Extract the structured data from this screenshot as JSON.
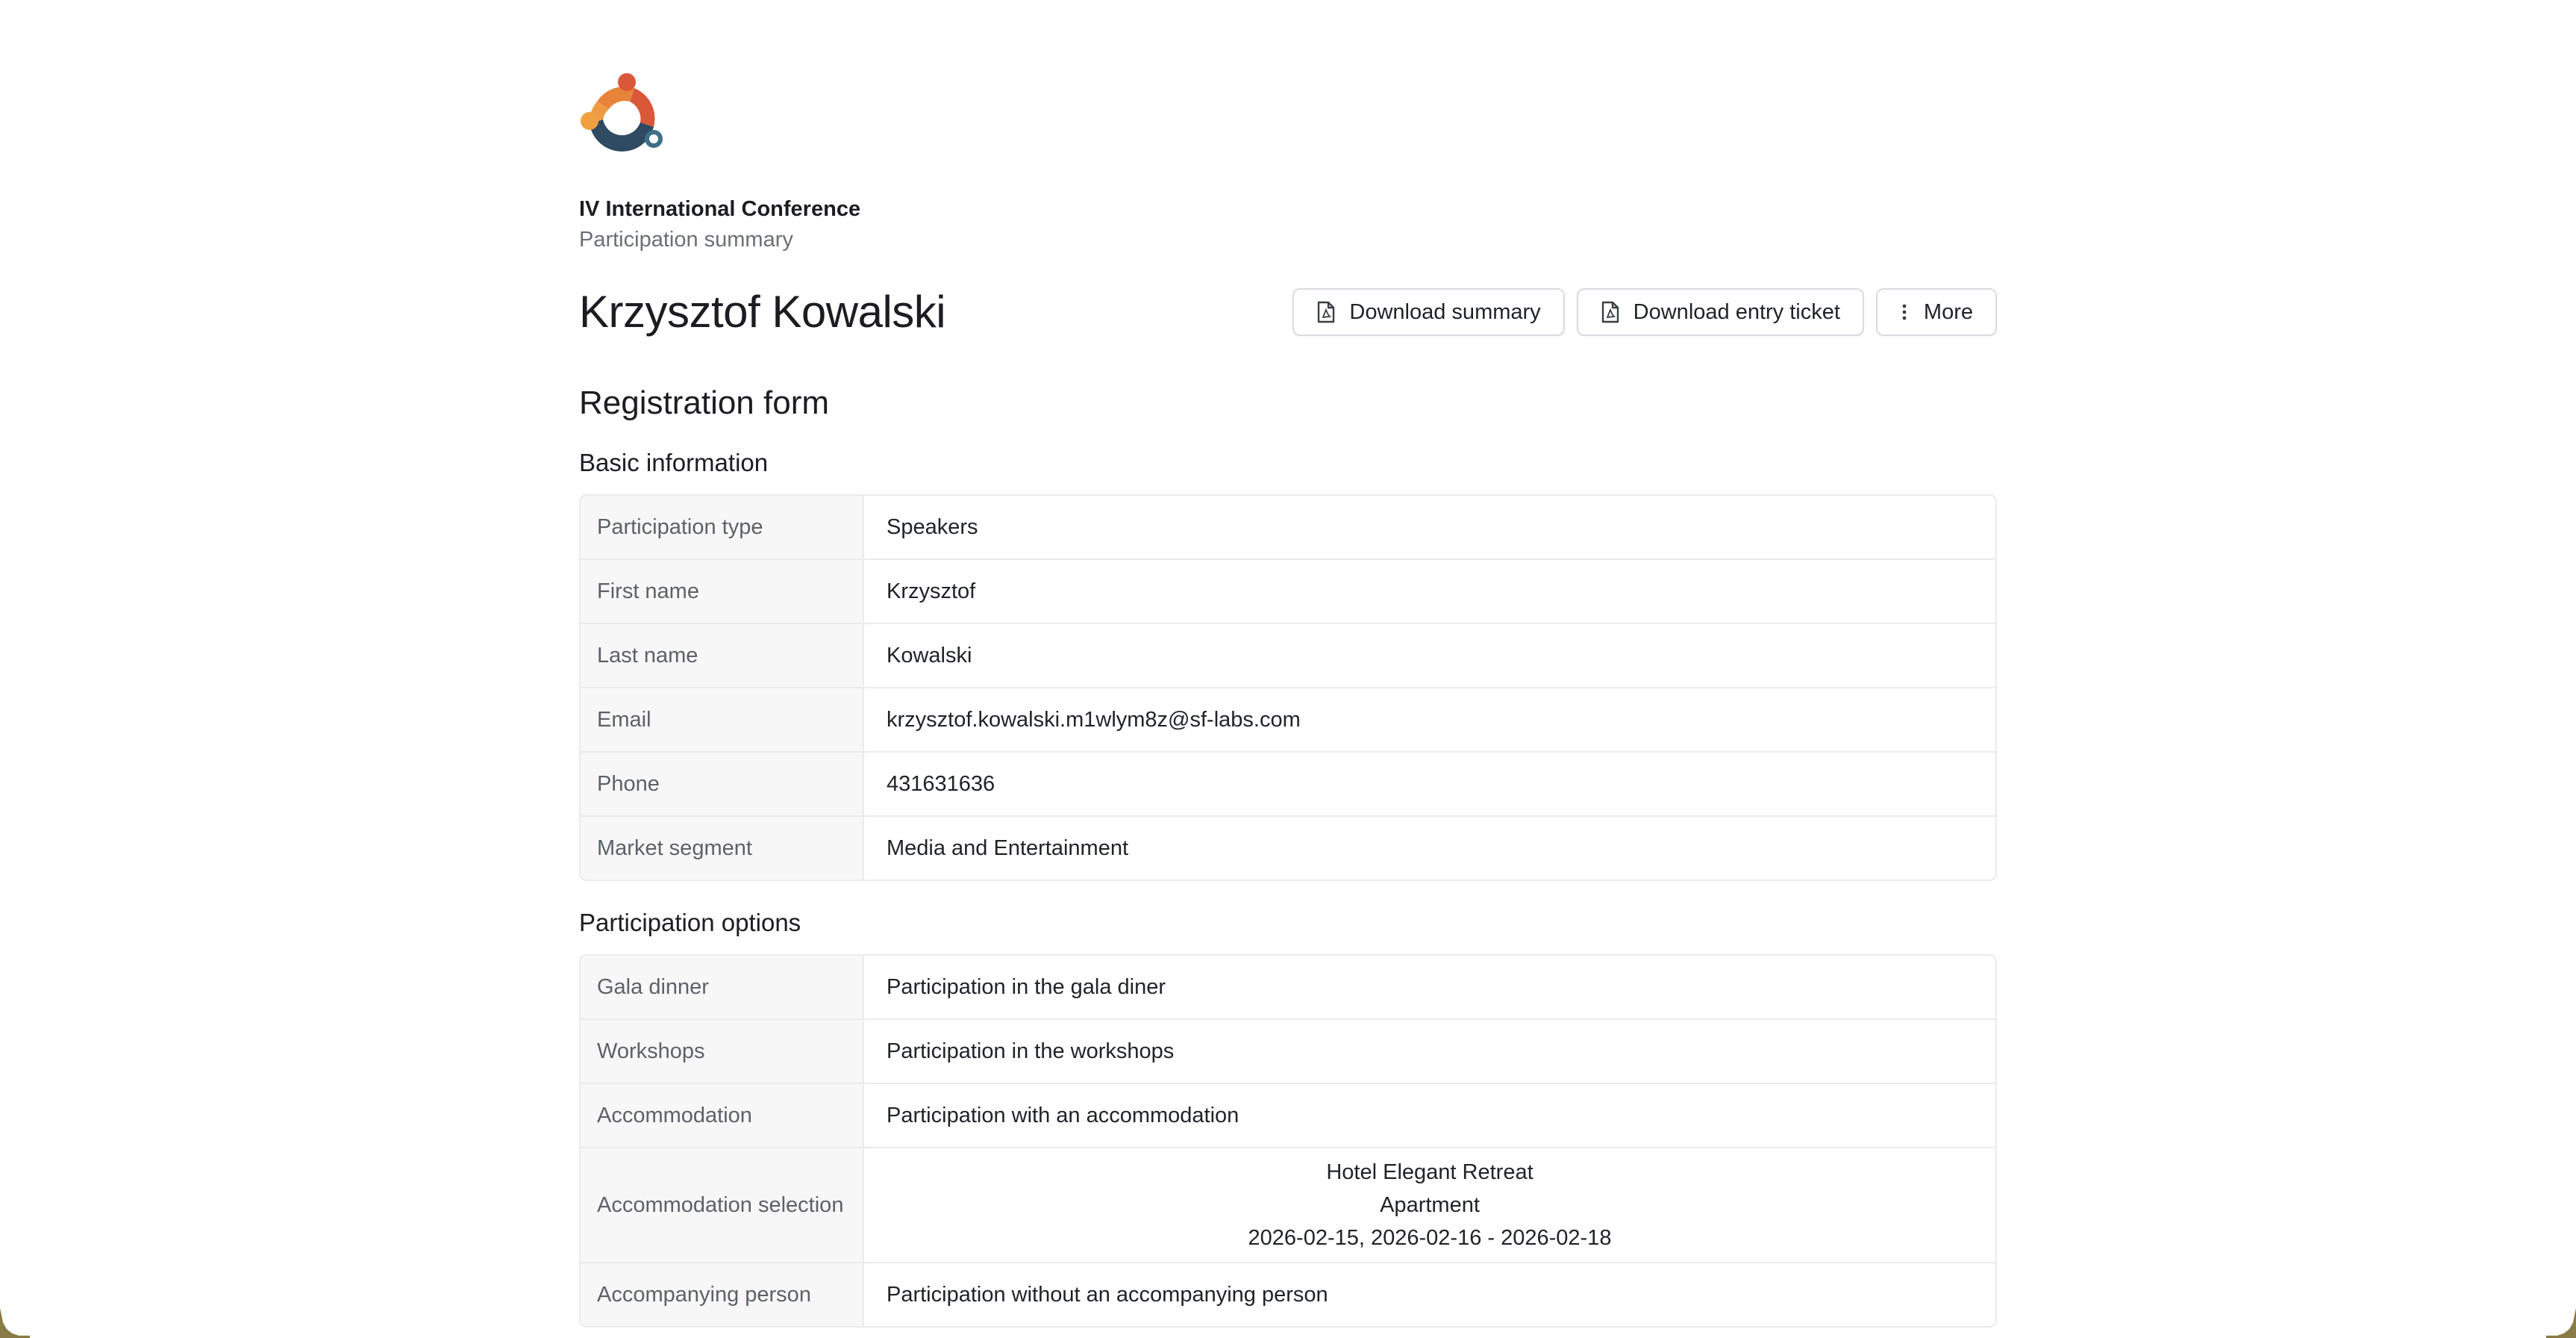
{
  "header": {
    "conference_title": "IV International Conference",
    "page_subtitle": "Participation summary",
    "person_name": "Krzysztof Kowalski"
  },
  "actions": {
    "download_summary": "Download summary",
    "download_ticket": "Download entry ticket",
    "more": "More"
  },
  "form": {
    "title": "Registration form",
    "basic": {
      "title": "Basic information",
      "rows": [
        {
          "label": "Participation type",
          "value": "Speakers"
        },
        {
          "label": "First name",
          "value": "Krzysztof"
        },
        {
          "label": "Last name",
          "value": "Kowalski"
        },
        {
          "label": "Email",
          "value": "krzysztof.kowalski.m1wlym8z@sf-labs.com"
        },
        {
          "label": "Phone",
          "value": "431631636"
        },
        {
          "label": "Market segment",
          "value": "Media and Entertainment"
        }
      ]
    },
    "options": {
      "title": "Participation options",
      "rows": [
        {
          "label": "Gala dinner",
          "value": "Participation in the gala diner"
        },
        {
          "label": "Workshops",
          "value": "Participation in the workshops"
        },
        {
          "label": "Accommodation",
          "value": "Participation with an accommodation"
        },
        {
          "label": "Accommodation selection",
          "lines": [
            "Hotel Elegant Retreat",
            "Apartment",
            "2026-02-15, 2026-02-16 - 2026-02-18"
          ]
        },
        {
          "label": "Accompanying person",
          "value": "Participation without an accompanying person"
        }
      ]
    }
  },
  "colors": {
    "logo_orange": "#e8843a",
    "logo_red": "#d9583a",
    "logo_navy": "#2f4a63",
    "logo_teal": "#3d6f86",
    "border": "#e9ebee",
    "label_bg": "#f7f7f8"
  },
  "icons": {
    "logo": "conference-logo",
    "download": "document-icon",
    "more": "kebab-menu-icon"
  }
}
